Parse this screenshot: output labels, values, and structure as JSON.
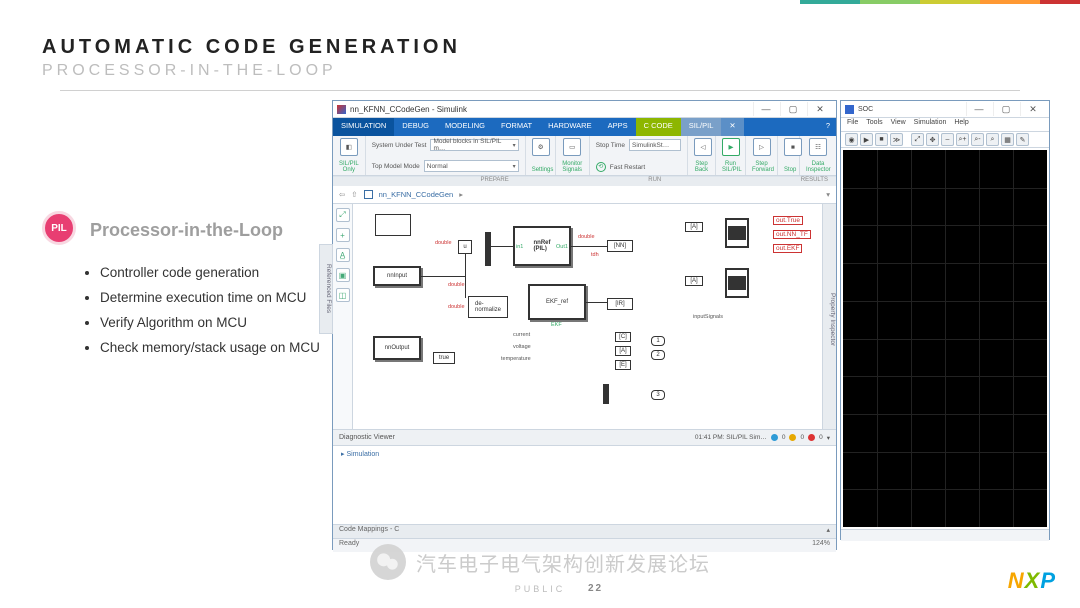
{
  "slide": {
    "title": "AUTOMATIC CODE GENERATION",
    "subtitle": "PROCESSOR-IN-THE-LOOP",
    "badge": "PIL",
    "heading": "Processor-in-the-Loop",
    "bullets": [
      "Controller code generation",
      "Determine execution time on MCU",
      "Verify Algorithm on MCU",
      "Check memory/stack usage on MCU"
    ],
    "watermark": "汽车电子电气架构创新发展论坛",
    "footer_public": "PUBLIC",
    "slide_num": "22",
    "logo": {
      "n": "N",
      "x": "X",
      "p": "P"
    }
  },
  "simulink": {
    "title": "nn_KFNN_CCodeGen - Simulink",
    "win_ctrls": {
      "min": "—",
      "max": "▢",
      "close": "✕"
    },
    "tabs": [
      "SIMULATION",
      "DEBUG",
      "MODELING",
      "FORMAT",
      "HARDWARE",
      "APPS",
      "C CODE",
      "SIL/PIL"
    ],
    "tab_x": "✕",
    "help_icon": "?",
    "toolstrip": {
      "mode_label": "SIL/PIL\nOnly",
      "sut_label": "System Under Test",
      "sut_value": "Model blocks in SIL/PIL m…",
      "top_label": "Top Model Mode",
      "top_value": "Normal",
      "settings": "Settings",
      "monitor": "Monitor\nSignals",
      "stop_time_label": "Stop Time",
      "stop_time_value": "SimulinkSt…",
      "fast_restart": "Fast Restart",
      "step_back": "Step\nBack",
      "run": "Run\nSIL/PIL",
      "step_fwd": "Step\nForward",
      "stop": "Stop",
      "data_insp": "Data\nInspector",
      "section_prepare": "PREPARE",
      "section_run": "RUN",
      "section_results": "RESULTS"
    },
    "breadcrumb": {
      "root": "nn_KFNN_CCodeGen"
    },
    "left_tab": "Referenced Files",
    "right_tab": "Property Inspector",
    "canvas": {
      "blocks": {
        "nnInput": "nnInput",
        "nnOutput": "nnOutput",
        "nnRef": "nnRef\n(PIL)",
        "nnRef_in": "in1",
        "nnRef_out": "Out1",
        "ekf": "EKF_ref",
        "ekf_sub": "EKF",
        "denorm": "de-\nnormalize",
        "true": "true",
        "f2d": "u",
        "nn_tag": "[NN]",
        "ir_tag": "[IR]",
        "a_tag": "[A]",
        "c_tag": "[C]",
        "e_tag": "[E]",
        "current": "current",
        "voltage": "voltage",
        "temperature": "temperature",
        "inputSignals": "inputSignals",
        "out1_num": "1",
        "out2_num": "2",
        "out3_num": "3",
        "out_true": "out.True",
        "out_nn": "out.NN_TF",
        "out_ekf": "out.EKF"
      },
      "dtype_double": "double",
      "dtype_tdh": "tdh"
    },
    "diag": {
      "title": "Diagnostic Viewer",
      "sim_label": "Simulation",
      "time": "01:41 PM: SIL/PIL Sim…",
      "info": "0",
      "warn": "0",
      "err": "0"
    },
    "codemap": "Code Mappings - C",
    "status": {
      "ready": "Ready",
      "zoom": "124%"
    }
  },
  "scope": {
    "title": "SOC",
    "menu": [
      "File",
      "Tools",
      "View",
      "Simulation",
      "Help"
    ],
    "toolbar_icons": [
      "◉",
      "▶",
      "■",
      "≫",
      "⤢",
      "✥",
      "–",
      "⌕+",
      "⌕-",
      "⌕",
      "▦",
      "✎"
    ],
    "win_ctrls": {
      "min": "—",
      "max": "▢",
      "close": "✕"
    }
  }
}
